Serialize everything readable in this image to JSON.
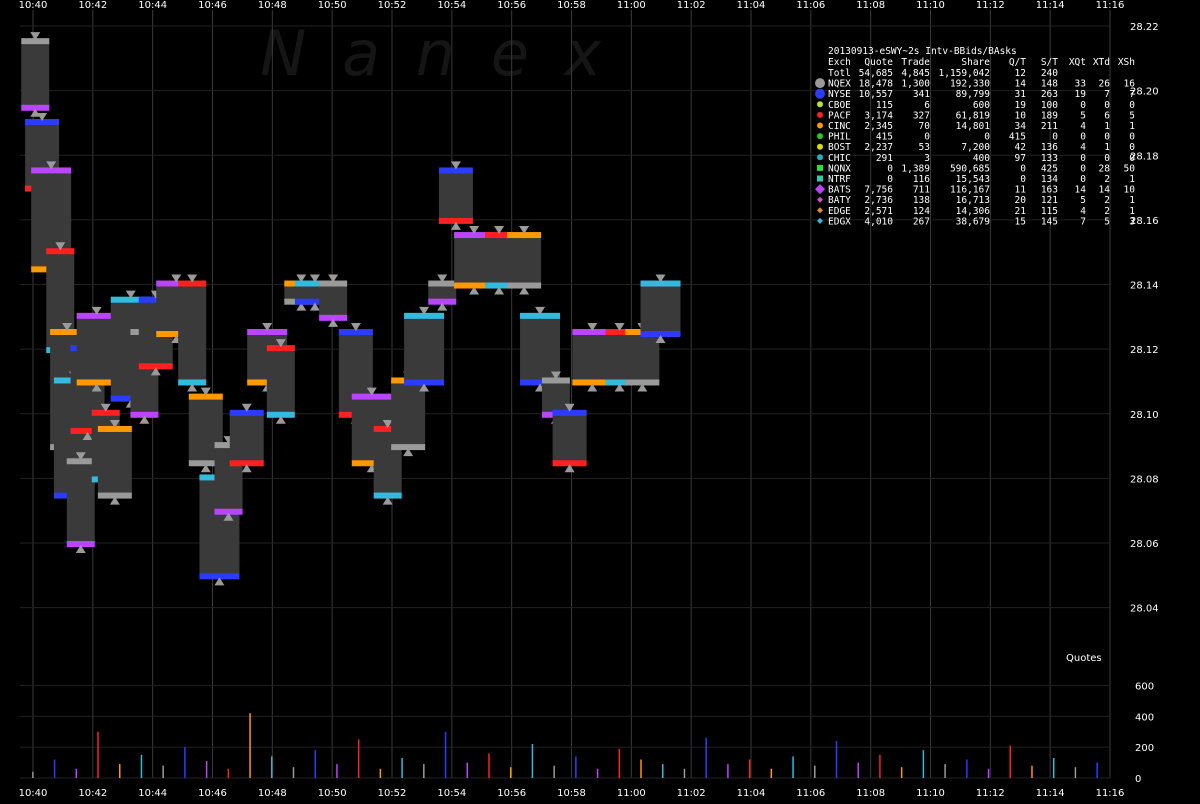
{
  "chart_data": {
    "type": "scatter",
    "title": "20130913-eSWY~2s Intv-BBids/BAsks",
    "watermark": "N a n e x",
    "x_ticks": [
      "10:40",
      "10:42",
      "10:44",
      "10:46",
      "10:48",
      "10:50",
      "10:52",
      "10:54",
      "10:56",
      "10:58",
      "11:00",
      "11:02",
      "11:04",
      "11:06",
      "11:08",
      "11:10",
      "11:12",
      "11:14",
      "11:16"
    ],
    "price_ticks": [
      "28.22",
      "28.20",
      "28.18",
      "28.16",
      "28.14",
      "28.12",
      "28.10",
      "28.08",
      "28.06",
      "28.04"
    ],
    "price_range": [
      28.03,
      28.22
    ],
    "volume_label": "Quotes",
    "volume_ticks": [
      "600",
      "400",
      "200",
      "0"
    ],
    "volume_range": [
      0,
      700
    ],
    "table": {
      "headers": [
        "Exch",
        "Quote",
        "Trade",
        "Share",
        "Q/T",
        "S/T",
        "XQt",
        "XTd",
        "XSh"
      ],
      "rows": [
        {
          "exch": "Totl",
          "quote": "54,685",
          "trade": "4,845",
          "share": "1,159,042",
          "qt": "12",
          "st": "240",
          "xqt": "",
          "xtd": "",
          "xsh": "",
          "color": "",
          "marker": ""
        },
        {
          "exch": "NQEX",
          "quote": "18,478",
          "trade": "1,300",
          "share": "192,330",
          "qt": "14",
          "st": "148",
          "xqt": "33",
          "xtd": "26",
          "xsh": "16",
          "color": "#9a9a9a",
          "marker": "circle-big"
        },
        {
          "exch": "NYSE",
          "quote": "10,557",
          "trade": "341",
          "share": "89,799",
          "qt": "31",
          "st": "263",
          "xqt": "19",
          "xtd": "7",
          "xsh": "7",
          "color": "#2b3cff",
          "marker": "circle-big"
        },
        {
          "exch": "CBOE",
          "quote": "115",
          "trade": "6",
          "share": "600",
          "qt": "19",
          "st": "100",
          "xqt": "0",
          "xtd": "0",
          "xsh": "0",
          "color": "#b5e33a",
          "marker": "circle"
        },
        {
          "exch": "PACF",
          "quote": "3,174",
          "trade": "327",
          "share": "61,819",
          "qt": "10",
          "st": "189",
          "xqt": "5",
          "xtd": "6",
          "xsh": "5",
          "color": "#ff2020",
          "marker": "circle"
        },
        {
          "exch": "CINC",
          "quote": "2,345",
          "trade": "70",
          "share": "14,801",
          "qt": "34",
          "st": "211",
          "xqt": "4",
          "xtd": "1",
          "xsh": "1",
          "color": "#ff9900",
          "marker": "circle"
        },
        {
          "exch": "PHIL",
          "quote": "415",
          "trade": "0",
          "share": "0",
          "qt": "415",
          "st": "0",
          "xqt": "0",
          "xtd": "0",
          "xsh": "0",
          "color": "#22cc22",
          "marker": "circle"
        },
        {
          "exch": "BOST",
          "quote": "2,237",
          "trade": "53",
          "share": "7,200",
          "qt": "42",
          "st": "136",
          "xqt": "4",
          "xtd": "1",
          "xsh": "0",
          "color": "#d8e000",
          "marker": "circle"
        },
        {
          "exch": "CHIC",
          "quote": "291",
          "trade": "3",
          "share": "400",
          "qt": "97",
          "st": "133",
          "xqt": "0",
          "xtd": "0",
          "xsh": "0",
          "color": "#20b0c0",
          "marker": "circle"
        },
        {
          "exch": "NQNX",
          "quote": "0",
          "trade": "1,389",
          "share": "590,685",
          "qt": "0",
          "st": "425",
          "xqt": "0",
          "xtd": "28",
          "xsh": "50",
          "color": "#33dd33",
          "marker": "square"
        },
        {
          "exch": "NTRF",
          "quote": "0",
          "trade": "116",
          "share": "15,543",
          "qt": "0",
          "st": "134",
          "xqt": "0",
          "xtd": "2",
          "xsh": "1",
          "color": "#33ccaa",
          "marker": "square"
        },
        {
          "exch": "BATS",
          "quote": "7,756",
          "trade": "711",
          "share": "116,167",
          "qt": "11",
          "st": "163",
          "xqt": "14",
          "xtd": "14",
          "xsh": "10",
          "color": "#bb44ff",
          "marker": "diamond-big"
        },
        {
          "exch": "BATY",
          "quote": "2,736",
          "trade": "138",
          "share": "16,713",
          "qt": "20",
          "st": "121",
          "xqt": "5",
          "xtd": "2",
          "xsh": "1",
          "color": "#cc55cc",
          "marker": "diamond"
        },
        {
          "exch": "EDGE",
          "quote": "2,571",
          "trade": "124",
          "share": "14,306",
          "qt": "21",
          "st": "115",
          "xqt": "4",
          "xtd": "2",
          "xsh": "1",
          "color": "#e09020",
          "marker": "diamond"
        },
        {
          "exch": "EDGX",
          "quote": "4,010",
          "trade": "267",
          "share": "38,679",
          "qt": "15",
          "st": "145",
          "xqt": "7",
          "xtd": "5",
          "xsh": "3",
          "color": "#33bbdd",
          "marker": "diamond"
        }
      ]
    },
    "bid_ask_segments": [
      {
        "t": 0.1,
        "bid": 28.195,
        "ask": 28.215
      },
      {
        "t": 0.4,
        "bid": 28.17,
        "ask": 28.19
      },
      {
        "t": 0.8,
        "bid": 28.145,
        "ask": 28.175
      },
      {
        "t": 1.2,
        "bid": 28.12,
        "ask": 28.15
      },
      {
        "t": 1.5,
        "bid": 28.09,
        "ask": 28.125
      },
      {
        "t": 1.8,
        "bid": 28.075,
        "ask": 28.11
      },
      {
        "t": 2.1,
        "bid": 28.06,
        "ask": 28.085
      },
      {
        "t": 2.4,
        "bid": 28.095,
        "ask": 28.12
      },
      {
        "t": 2.8,
        "bid": 28.11,
        "ask": 28.13
      },
      {
        "t": 3.2,
        "bid": 28.08,
        "ask": 28.1
      },
      {
        "t": 3.6,
        "bid": 28.075,
        "ask": 28.095
      },
      {
        "t": 4.3,
        "bid": 28.105,
        "ask": 28.135
      },
      {
        "t": 4.9,
        "bid": 28.1,
        "ask": 28.125
      },
      {
        "t": 5.4,
        "bid": 28.115,
        "ask": 28.135
      },
      {
        "t": 6.3,
        "bid": 28.125,
        "ask": 28.14
      },
      {
        "t": 7.0,
        "bid": 28.11,
        "ask": 28.14
      },
      {
        "t": 7.6,
        "bid": 28.085,
        "ask": 28.105
      },
      {
        "t": 8.2,
        "bid": 28.05,
        "ask": 28.08
      },
      {
        "t": 8.6,
        "bid": 28.07,
        "ask": 28.09
      },
      {
        "t": 9.4,
        "bid": 28.085,
        "ask": 28.1
      },
      {
        "t": 10.3,
        "bid": 28.11,
        "ask": 28.125
      },
      {
        "t": 10.9,
        "bid": 28.1,
        "ask": 28.12
      },
      {
        "t": 11.8,
        "bid": 28.135,
        "ask": 28.14
      },
      {
        "t": 12.4,
        "bid": 28.135,
        "ask": 28.14
      },
      {
        "t": 13.2,
        "bid": 28.13,
        "ask": 28.14
      },
      {
        "t": 14.2,
        "bid": 28.1,
        "ask": 28.125
      },
      {
        "t": 14.9,
        "bid": 28.085,
        "ask": 28.105
      },
      {
        "t": 15.6,
        "bid": 28.075,
        "ask": 28.095
      },
      {
        "t": 16.5,
        "bid": 28.09,
        "ask": 28.11
      },
      {
        "t": 17.2,
        "bid": 28.11,
        "ask": 28.13
      },
      {
        "t": 18.0,
        "bid": 28.135,
        "ask": 28.14
      },
      {
        "t": 18.6,
        "bid": 28.16,
        "ask": 28.175
      },
      {
        "t": 19.4,
        "bid": 28.14,
        "ask": 28.155
      },
      {
        "t": 20.5,
        "bid": 28.14,
        "ask": 28.155
      },
      {
        "t": 21.6,
        "bid": 28.14,
        "ask": 28.155
      },
      {
        "t": 22.3,
        "bid": 28.11,
        "ask": 28.13
      },
      {
        "t": 23.0,
        "bid": 28.1,
        "ask": 28.11
      },
      {
        "t": 23.6,
        "bid": 28.085,
        "ask": 28.1
      },
      {
        "t": 24.6,
        "bid": 28.11,
        "ask": 28.125
      },
      {
        "t": 25.8,
        "bid": 28.11,
        "ask": 28.125
      },
      {
        "t": 26.8,
        "bid": 28.11,
        "ask": 28.125
      },
      {
        "t": 27.6,
        "bid": 28.125,
        "ask": 28.14
      }
    ],
    "volume": [
      40,
      120,
      60,
      300,
      90,
      150,
      80,
      200,
      110,
      60,
      420,
      140,
      70,
      180,
      90,
      250,
      60,
      130,
      90,
      300,
      100,
      160,
      70,
      220,
      80,
      140,
      60,
      190,
      120,
      90,
      60,
      260,
      90,
      120,
      60,
      140,
      80,
      240,
      100,
      150,
      70,
      180,
      90,
      120,
      60,
      210,
      80,
      130,
      70,
      100
    ]
  }
}
